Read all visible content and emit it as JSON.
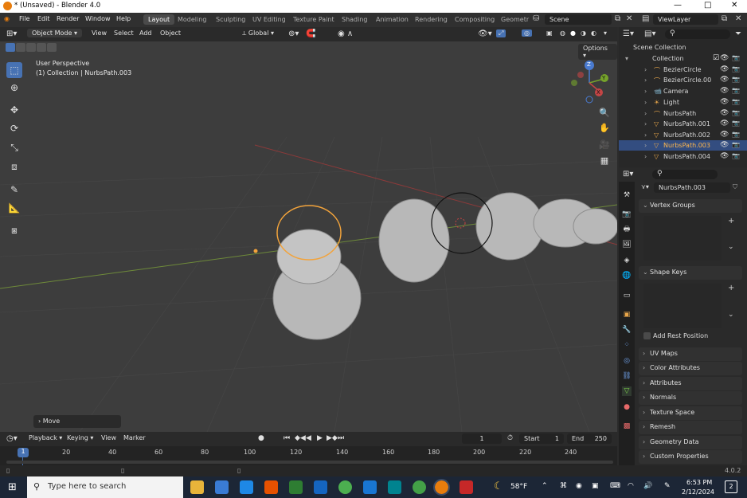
{
  "window": {
    "title": "* (Unsaved) - Blender 4.0",
    "minimize": "—",
    "maximize": "□",
    "close": "✕"
  },
  "menu": [
    "File",
    "Edit",
    "Render",
    "Window",
    "Help"
  ],
  "workspaces": [
    "Layout",
    "Modeling",
    "Sculpting",
    "UV Editing",
    "Texture Paint",
    "Shading",
    "Animation",
    "Rendering",
    "Compositing",
    "Geometr"
  ],
  "scene": "Scene",
  "view_layer": "ViewLayer",
  "viewport_header": {
    "mode": "Object Mode",
    "view": "View",
    "select": "Select",
    "add": "Add",
    "object": "Object",
    "orientation": "Global",
    "options": "Options"
  },
  "viewport": {
    "perspective": "User Perspective",
    "context": "(1) Collection | NurbsPath.003",
    "last_op": "Move"
  },
  "gizmo": {
    "x": "X",
    "y": "Y",
    "z": "Z"
  },
  "outliner": {
    "root": "Scene Collection",
    "collection": "Collection",
    "items": [
      {
        "name": "BezierCircle",
        "color": "#e8a64a"
      },
      {
        "name": "BezierCircle.00",
        "color": "#e8a64a"
      },
      {
        "name": "Camera",
        "color": "#a0a0a0"
      },
      {
        "name": "Light",
        "color": "#a0a0a0"
      },
      {
        "name": "NurbsPath",
        "color": "#e8a64a"
      },
      {
        "name": "NurbsPath.001",
        "color": "#e8a64a"
      },
      {
        "name": "NurbsPath.002",
        "color": "#e8a64a"
      },
      {
        "name": "NurbsPath.003",
        "color": "#e8a64a",
        "selected": true
      },
      {
        "name": "NurbsPath.004",
        "color": "#e8a64a"
      }
    ]
  },
  "properties": {
    "object_name": "NurbsPath.003",
    "vertex_groups": "Vertex Groups",
    "shape_keys": "Shape Keys",
    "add_rest_position": "Add Rest Position",
    "panels": [
      "UV Maps",
      "Color Attributes",
      "Attributes",
      "Normals",
      "Texture Space",
      "Remesh",
      "Geometry Data",
      "Custom Properties"
    ]
  },
  "timeline": {
    "playback": "Playback",
    "keying": "Keying",
    "view": "View",
    "marker": "Marker",
    "current_frame": "1",
    "start_label": "Start",
    "start": "1",
    "end_label": "End",
    "end": "250",
    "cursor": "1",
    "ticks": [
      "20",
      "40",
      "60",
      "80",
      "100",
      "120",
      "140",
      "160",
      "180",
      "200",
      "220",
      "240"
    ]
  },
  "statusbar": {
    "version": "4.0.2"
  },
  "taskbar": {
    "search_placeholder": "Type here to search",
    "weather": "58°F",
    "time": "6:53 PM",
    "date": "2/12/2024",
    "notifications": "2"
  },
  "colors": {
    "accent": "#4772b3",
    "selected_object": "#e8a64a",
    "viewport_bg": "#3d3d3d"
  }
}
